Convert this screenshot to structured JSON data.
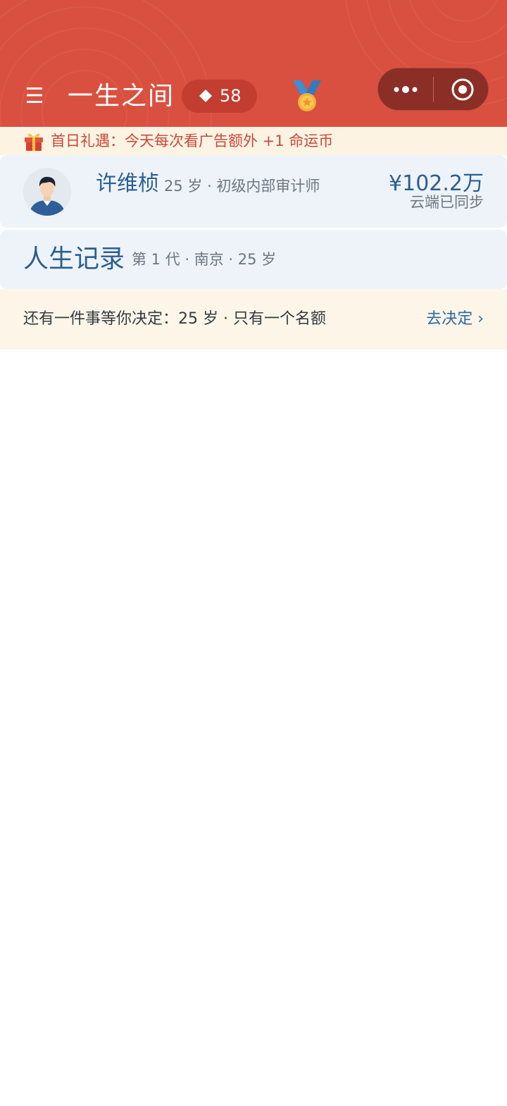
{
  "header": {
    "menu_icon": "hamburger-icon",
    "menu_glyph": "☰",
    "title": "一生之间",
    "coin": {
      "icon": "diamond-icon",
      "count": "58"
    },
    "medal_icon": "medal-icon",
    "capsule": {
      "more_icon": "more-dots-icon",
      "close_icon": "target-close-icon"
    },
    "colors": {
      "background": "#d95040",
      "pill": "#c33d31",
      "capsule": "#8a2e26"
    }
  },
  "gift_banner": {
    "icon": "gift-icon",
    "text": "首日礼遇：今天每次看广告额外 +1 命运币"
  },
  "profile": {
    "avatar_icon": "avatar",
    "name": "许维桢",
    "meta": "25 岁 · 初级内部审计师",
    "money": "¥102.2万",
    "sync": "云端已同步"
  },
  "record": {
    "title": "人生记录",
    "meta": "第 1 代 · 南京 · 25 岁"
  },
  "decision": {
    "text": "还有一件事等你决定：25 岁 · 只有一个名额",
    "link": "去决定 ›"
  }
}
